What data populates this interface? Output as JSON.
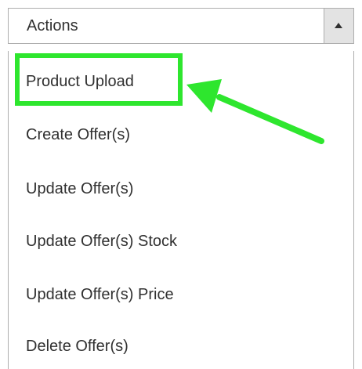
{
  "dropdown": {
    "label": "Actions",
    "items": [
      {
        "label": "Product Upload"
      },
      {
        "label": "Create Offer(s)"
      },
      {
        "label": "Update Offer(s)"
      },
      {
        "label": "Update Offer(s) Stock"
      },
      {
        "label": "Update Offer(s) Price"
      },
      {
        "label": "Delete Offer(s)"
      }
    ]
  },
  "colors": {
    "annotation": "#2ee62e",
    "text": "#303030",
    "border": "#adadad",
    "toggle_bg": "#e3e3e3"
  },
  "icons": {
    "toggle": "caret-up-icon",
    "annotation": "arrow-left-icon"
  }
}
